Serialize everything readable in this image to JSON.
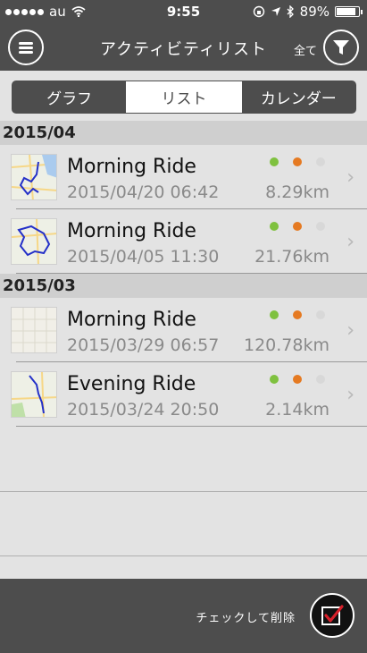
{
  "status_bar": {
    "carrier": "au",
    "time": "9:55",
    "battery": "89%"
  },
  "nav": {
    "title": "アクティビティリスト",
    "filter_label": "全て",
    "menu_icon": "hamburger-icon",
    "filter_icon": "funnel-icon"
  },
  "tabs": [
    {
      "label": "グラフ",
      "active": false
    },
    {
      "label": "リスト",
      "active": true
    },
    {
      "label": "カレンダー",
      "active": false
    }
  ],
  "sections": [
    {
      "header": "2015/04",
      "items": [
        {
          "title": "Morning Ride",
          "date": "2015/04/20 06:42",
          "distance": "8.29km",
          "dots": [
            "#7fc13f",
            "#e57a22",
            "#d8d8d8"
          ]
        },
        {
          "title": "Morning Ride",
          "date": "2015/04/05 11:30",
          "distance": "21.76km",
          "dots": [
            "#7fc13f",
            "#e57a22",
            "#d8d8d8"
          ]
        }
      ]
    },
    {
      "header": "2015/03",
      "items": [
        {
          "title": "Morning Ride",
          "date": "2015/03/29 06:57",
          "distance": "120.78km",
          "dots": [
            "#7fc13f",
            "#e57a22",
            "#d8d8d8"
          ]
        },
        {
          "title": "Evening Ride",
          "date": "2015/03/24 20:50",
          "distance": "2.14km",
          "dots": [
            "#7fc13f",
            "#e57a22",
            "#d8d8d8"
          ]
        }
      ]
    }
  ],
  "bottom": {
    "delete_label": "チェックして削除",
    "check_icon": "checkbox-checked-icon"
  },
  "colors": {
    "bar": "#4d4d4d",
    "background": "#e3e3e3",
    "section": "#cfcfcf",
    "accent_red": "#d8202a"
  }
}
